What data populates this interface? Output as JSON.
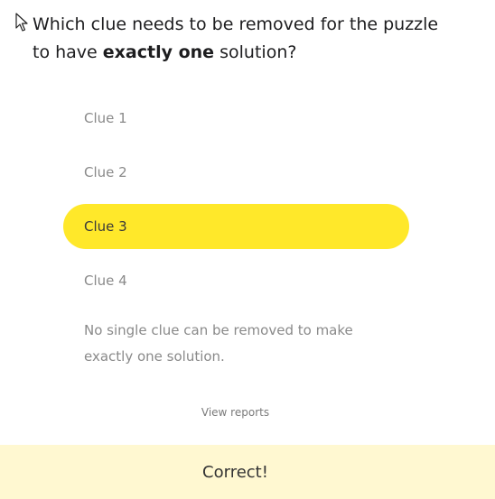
{
  "question": {
    "part1": "Which clue needs to be removed for the puzzle to have ",
    "emphasis": "exactly one",
    "part2": " solution?"
  },
  "options": [
    {
      "label": "Clue 1",
      "selected": false
    },
    {
      "label": "Clue 2",
      "selected": false
    },
    {
      "label": "Clue 3",
      "selected": true
    },
    {
      "label": "Clue 4",
      "selected": false
    },
    {
      "label": "No single clue can be removed to make exactly one solution.",
      "selected": false
    }
  ],
  "view_reports_label": "View reports",
  "result": {
    "text": "Correct!"
  },
  "colors": {
    "selected_bg": "#ffe82a",
    "result_bg": "#fff8d1"
  },
  "icons": {
    "cursor": "mouse-pointer-icon"
  }
}
